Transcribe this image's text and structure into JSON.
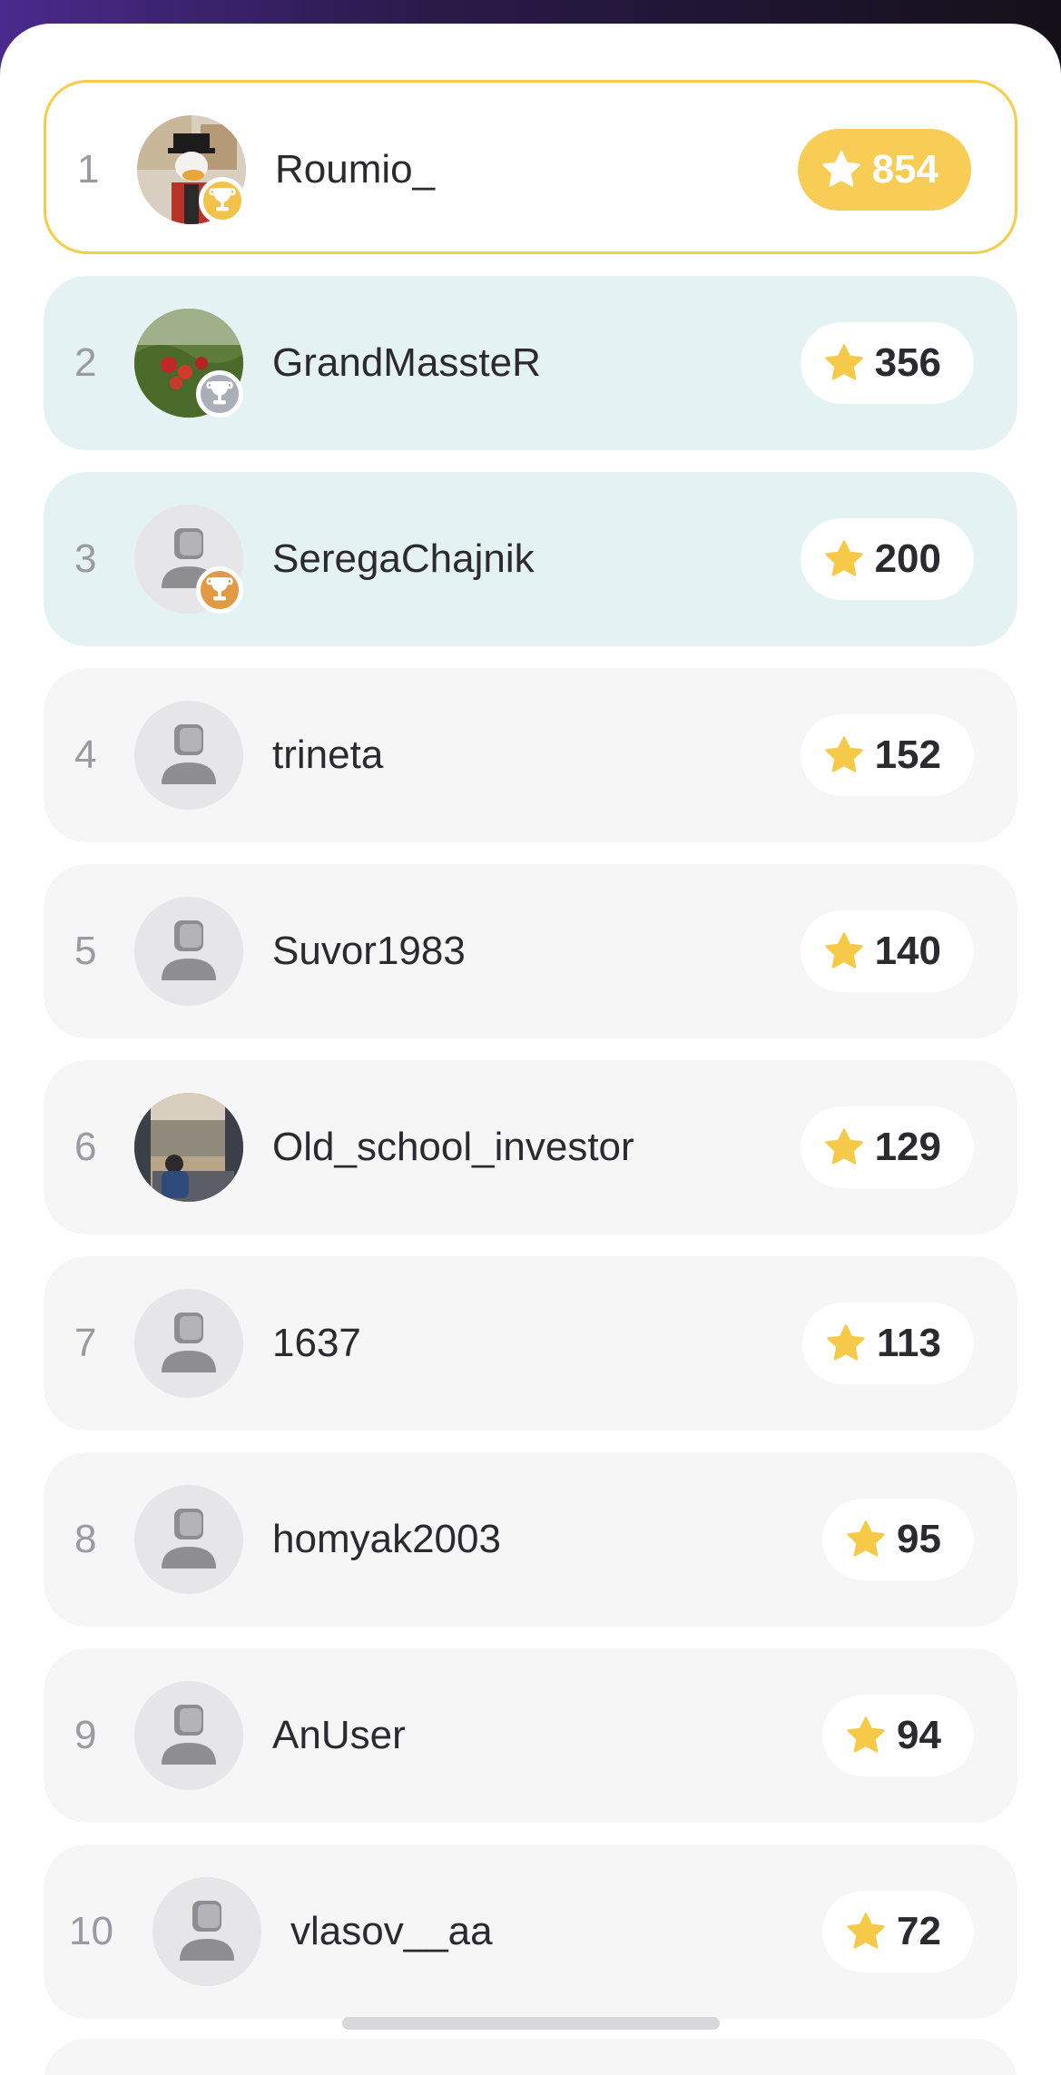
{
  "leaderboard": [
    {
      "rank": "1",
      "name": "Roumio_",
      "score": "854",
      "avatar": "photo-duck",
      "medal": "gold"
    },
    {
      "rank": "2",
      "name": "GrandMassteR",
      "score": "356",
      "avatar": "photo-strawberries",
      "medal": "silver"
    },
    {
      "rank": "3",
      "name": "SeregaChajnik",
      "score": "200",
      "avatar": "default",
      "medal": "bronze"
    },
    {
      "rank": "4",
      "name": "trineta",
      "score": "152",
      "avatar": "default"
    },
    {
      "rank": "5",
      "name": "Suvor1983",
      "score": "140",
      "avatar": "default"
    },
    {
      "rank": "6",
      "name": "Old_school_investor",
      "score": "129",
      "avatar": "photo-city"
    },
    {
      "rank": "7",
      "name": "1637",
      "score": "113",
      "avatar": "default"
    },
    {
      "rank": "8",
      "name": "homyak2003",
      "score": "95",
      "avatar": "default"
    },
    {
      "rank": "9",
      "name": "AnUser",
      "score": "94",
      "avatar": "default"
    },
    {
      "rank": "10",
      "name": "vlasov__aa",
      "score": "72",
      "avatar": "default"
    }
  ],
  "icons": {
    "score": "star-icon",
    "medal": "trophy-icon",
    "avatar_default": "user-icon"
  },
  "colors": {
    "gold": "#f5cd4a",
    "highlight": "#e5f2f4",
    "row": "#f6f6f7",
    "star": "#f7c948"
  }
}
